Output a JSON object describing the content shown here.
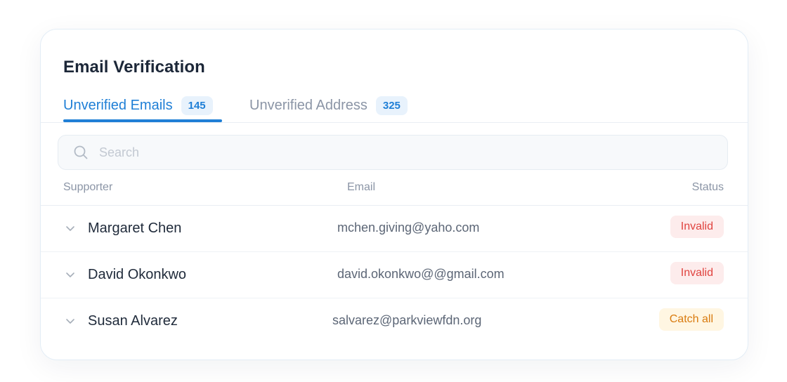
{
  "card": {
    "title": "Email Verification"
  },
  "tabs": [
    {
      "label": "Unverified Emails",
      "count": "145",
      "active": true
    },
    {
      "label": "Unverified Address",
      "count": "325",
      "active": false
    }
  ],
  "search": {
    "placeholder": "Search",
    "value": ""
  },
  "table": {
    "columns": [
      "Supporter",
      "Email",
      "Status"
    ],
    "rows": [
      {
        "supporter": "Margaret Chen",
        "email": "mchen.giving@yaho.com",
        "status": "Invalid"
      },
      {
        "supporter": "David Okonkwo",
        "email": "david.okonkwo@@gmail.com",
        "status": "Invalid"
      },
      {
        "supporter": "Susan Alvarez",
        "email": "salvarez@parkviewfdn.org",
        "status": "Catch all"
      }
    ]
  },
  "colors": {
    "accent": "#1f7fd6",
    "invalid_text": "#e0433f",
    "invalid_bg": "#fdecec",
    "catch_all_text": "#d97b0f",
    "catch_all_bg": "#fff6e2"
  },
  "icons": {
    "search": "search-icon",
    "row_expand": "chevron-down-icon"
  }
}
